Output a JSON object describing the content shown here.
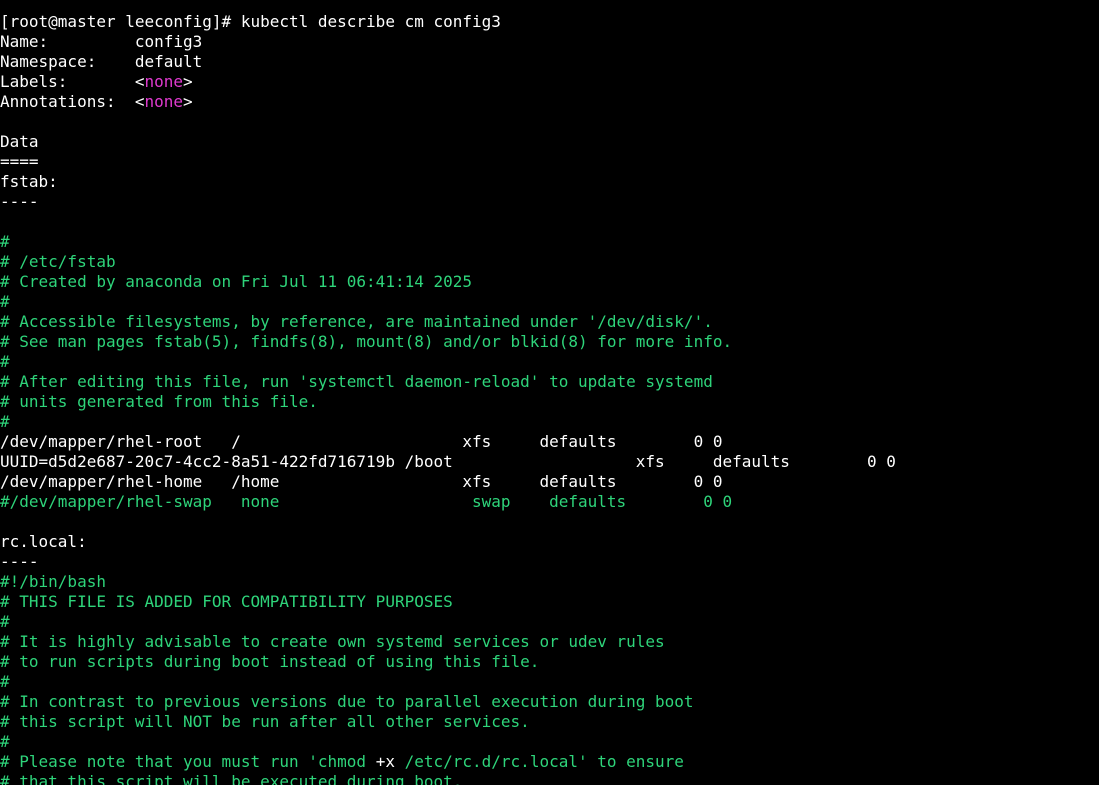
{
  "colors": {
    "background": "#000000",
    "default_text": "#ffffff",
    "comment_green": "#2ed47a",
    "none_magenta": "#e13bd0"
  },
  "terminal": {
    "lines": [
      {
        "spans": [
          {
            "text": "[root@master leeconfig]# kubectl describe cm config3",
            "c": "w"
          }
        ]
      },
      {
        "spans": [
          {
            "text": "Name:         config3",
            "c": "w"
          }
        ]
      },
      {
        "spans": [
          {
            "text": "Namespace:    default",
            "c": "w"
          }
        ]
      },
      {
        "spans": [
          {
            "text": "Labels:       <",
            "c": "w"
          },
          {
            "text": "none",
            "c": "m"
          },
          {
            "text": ">",
            "c": "w"
          }
        ]
      },
      {
        "spans": [
          {
            "text": "Annotations:  <",
            "c": "w"
          },
          {
            "text": "none",
            "c": "m"
          },
          {
            "text": ">",
            "c": "w"
          }
        ]
      },
      {
        "spans": [
          {
            "text": "",
            "c": "w"
          }
        ]
      },
      {
        "spans": [
          {
            "text": "Data",
            "c": "w"
          }
        ]
      },
      {
        "spans": [
          {
            "text": "====",
            "c": "w"
          }
        ]
      },
      {
        "spans": [
          {
            "text": "fstab:",
            "c": "w"
          }
        ]
      },
      {
        "spans": [
          {
            "text": "----",
            "c": "w"
          }
        ]
      },
      {
        "spans": [
          {
            "text": "",
            "c": "w"
          }
        ]
      },
      {
        "spans": [
          {
            "text": "#",
            "c": "g"
          }
        ]
      },
      {
        "spans": [
          {
            "text": "# /etc/fstab",
            "c": "g"
          }
        ]
      },
      {
        "spans": [
          {
            "text": "# Created by anaconda on Fri Jul 11 06:41:14 2025",
            "c": "g"
          }
        ]
      },
      {
        "spans": [
          {
            "text": "#",
            "c": "g"
          }
        ]
      },
      {
        "spans": [
          {
            "text": "# Accessible filesystems, by reference, are maintained under '/dev/disk/'.",
            "c": "g"
          }
        ]
      },
      {
        "spans": [
          {
            "text": "# See man pages fstab(5), findfs(8), mount(8) and/or blkid(8) for more info.",
            "c": "g"
          }
        ]
      },
      {
        "spans": [
          {
            "text": "#",
            "c": "g"
          }
        ]
      },
      {
        "spans": [
          {
            "text": "# After editing this file, run 'systemctl daemon-reload' to update systemd",
            "c": "g"
          }
        ]
      },
      {
        "spans": [
          {
            "text": "# units generated from this file.",
            "c": "g"
          }
        ]
      },
      {
        "spans": [
          {
            "text": "#",
            "c": "g"
          }
        ]
      },
      {
        "spans": [
          {
            "text": "/dev/mapper/rhel-root   /                       xfs     defaults        0 0",
            "c": "w"
          }
        ]
      },
      {
        "spans": [
          {
            "text": "UUID=d5d2e687-20c7-4cc2-8a51-422fd716719b /boot                   xfs     defaults        0 0",
            "c": "w"
          }
        ]
      },
      {
        "spans": [
          {
            "text": "/dev/mapper/rhel-home   /home                   xfs     defaults        0 0",
            "c": "w"
          }
        ]
      },
      {
        "spans": [
          {
            "text": "#/dev/mapper/rhel-swap   none                    swap    defaults        0 0",
            "c": "g"
          }
        ]
      },
      {
        "spans": [
          {
            "text": "",
            "c": "w"
          }
        ]
      },
      {
        "spans": [
          {
            "text": "rc.local:",
            "c": "w"
          }
        ]
      },
      {
        "spans": [
          {
            "text": "----",
            "c": "w"
          }
        ]
      },
      {
        "spans": [
          {
            "text": "#!/bin/bash",
            "c": "g"
          }
        ]
      },
      {
        "spans": [
          {
            "text": "# THIS FILE IS ADDED FOR COMPATIBILITY PURPOSES",
            "c": "g"
          }
        ]
      },
      {
        "spans": [
          {
            "text": "#",
            "c": "g"
          }
        ]
      },
      {
        "spans": [
          {
            "text": "# It is highly advisable to create own systemd services or udev rules",
            "c": "g"
          }
        ]
      },
      {
        "spans": [
          {
            "text": "# to run scripts during boot instead of using this file.",
            "c": "g"
          }
        ]
      },
      {
        "spans": [
          {
            "text": "#",
            "c": "g"
          }
        ]
      },
      {
        "spans": [
          {
            "text": "# In contrast to previous versions due to parallel execution during boot",
            "c": "g"
          }
        ]
      },
      {
        "spans": [
          {
            "text": "# this script will NOT be run after all other services.",
            "c": "g"
          }
        ]
      },
      {
        "spans": [
          {
            "text": "#",
            "c": "g"
          }
        ]
      },
      {
        "spans": [
          {
            "text": "# Please note that you must run 'chmod ",
            "c": "g"
          },
          {
            "text": "+x",
            "c": "w"
          },
          {
            "text": " /etc/rc.d/rc.local' to ensure",
            "c": "g"
          }
        ]
      },
      {
        "spans": [
          {
            "text": "# that this script will be executed during boot.",
            "c": "g"
          }
        ]
      }
    ]
  }
}
